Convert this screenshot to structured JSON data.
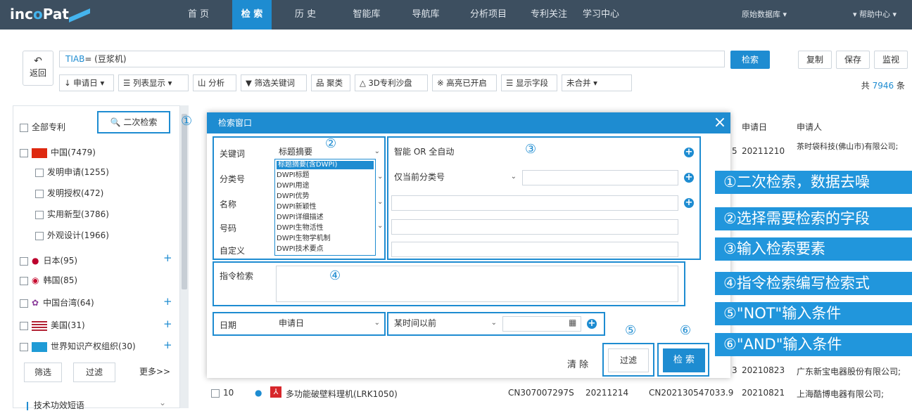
{
  "app": {
    "logo_in": "inc",
    "logo_o": "o",
    "logo_pat": "Pat"
  },
  "nav": {
    "items": [
      "首 页",
      "检 索",
      "历 史",
      "智能库",
      "导航库",
      "分析项目",
      "专利关注",
      "学习中心"
    ],
    "active": "检 索",
    "db": "原始数据库 ▾",
    "help": "▾ 帮助中心 ▾"
  },
  "search": {
    "back_label": "返回",
    "query_field": "TIAB",
    "query_rest": "= (豆浆机)",
    "search_button": "检索",
    "copy": "复制",
    "save": "保存",
    "monitor": "监视"
  },
  "toolbar": {
    "items": [
      "↓ 申请日 ▾",
      "☰ 列表显示 ▾",
      "山 分析",
      "▼ 筛选关键词",
      "品 聚类",
      "△ 3D专利沙盘",
      "※ 高亮已开启",
      "☰ 显示字段",
      "未合并 ▾"
    ],
    "count_prefix": "共 ",
    "count": "7946",
    "count_suffix": " 条"
  },
  "sidebar": {
    "all": "全部专利",
    "second_search": "二次检索",
    "cn": "中国(7479)",
    "cn_sub": [
      "发明申请(1255)",
      "发明授权(472)",
      "实用新型(3786)",
      "外观设计(1966)"
    ],
    "countries": [
      "日本(95)",
      "韩国(85)",
      "中国台湾(64)",
      "美国(31)",
      "世界知识产权组织(30)"
    ],
    "filter_btn": "筛选",
    "exclude_btn": "过滤",
    "more": "更多>>",
    "section": "技术功效短语"
  },
  "table": {
    "headers": [
      "申请日",
      "申请人"
    ],
    "rows": [
      {
        "prefix": "5",
        "date": "20211210",
        "applicant": "茶时袋科技(佛山市)有限公司;"
      },
      {
        "prefix": "3",
        "date": "20210823",
        "applicant": "广东新宝电器股份有限公司;"
      }
    ],
    "last_row": {
      "index": "10",
      "title": "多功能破壁料理机(LRK1050)",
      "pub": "CN307007297S",
      "pubdate": "20211214",
      "appno": "CN202130547033.9",
      "date": "20210821",
      "applicant": "上海酷博电器有限公司;"
    }
  },
  "modal": {
    "title": "检索窗口",
    "close": "×",
    "labels": [
      "关键词",
      "分类号",
      "名称",
      "号码",
      "自定义"
    ],
    "keyword_field": "标题摘要",
    "keyword_mode": "智能 OR 全自动",
    "class_mode": "仅当前分类号",
    "command_label": "指令检索",
    "date_label": "日期",
    "date_field": "申请日",
    "date_mode": "某时间以前",
    "clear": "清 除",
    "filter": "过滤",
    "search": "检 索",
    "dropdown": [
      "标题摘要(含DWPI)",
      "DWPI标题",
      "DWPI用途",
      "DWPI优势",
      "DWPI新颖性",
      "DWPI详细描述",
      "DWPI生物活性",
      "DWPI生物学机制",
      "DWPI技术要点"
    ],
    "circled": [
      "①",
      "②",
      "③",
      "④",
      "⑤",
      "⑥"
    ]
  },
  "callouts": [
    "①二次检索，数据去噪",
    "②选择需要检索的字段",
    "③输入检索要素",
    "④指令检索编写检索式",
    "⑤\"NOT\"输入条件",
    "⑥\"AND\"输入条件"
  ],
  "colors": {
    "nav_bg": "#3d4f60",
    "accent": "#1e8cd1",
    "callout": "#2196dc"
  }
}
